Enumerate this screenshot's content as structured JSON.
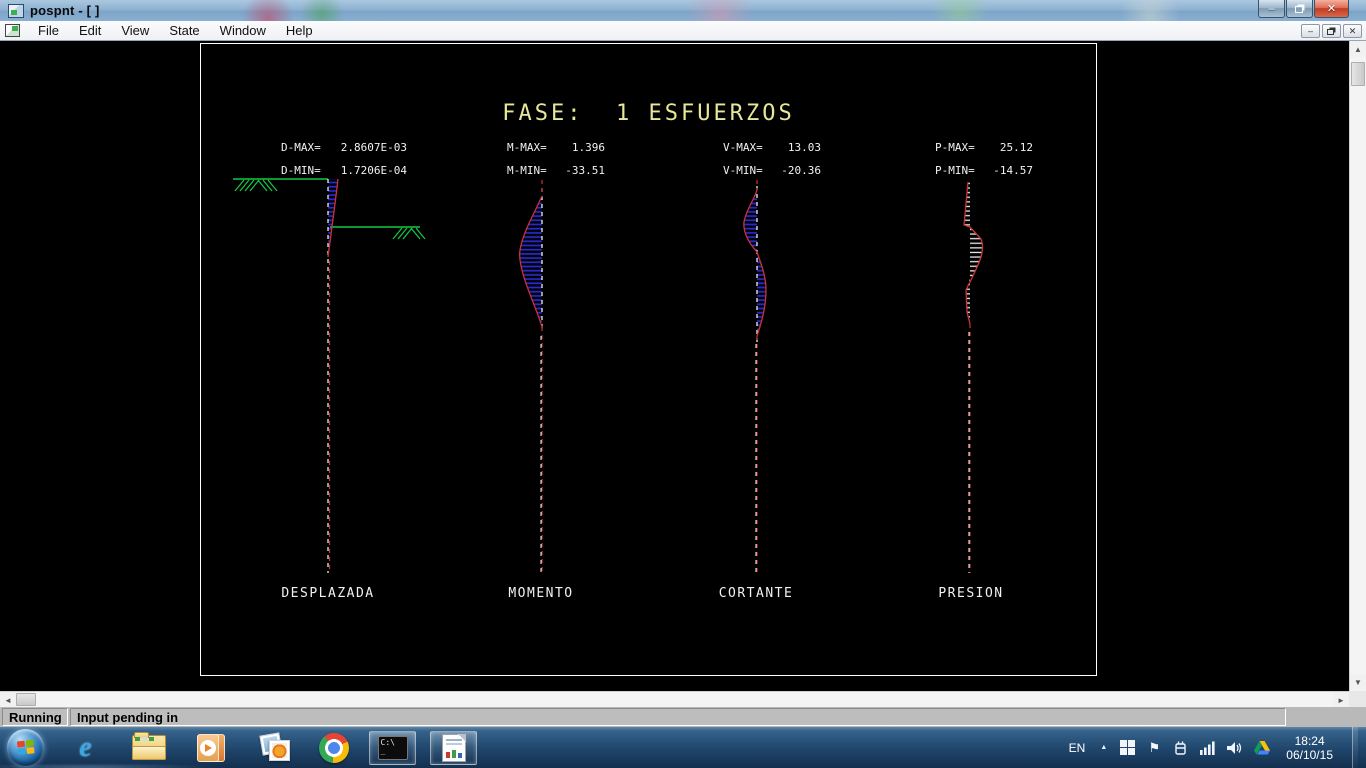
{
  "titlebar": {
    "title": "pospnt - [ ]"
  },
  "icons": {
    "minimize": "–",
    "close": "✕",
    "mdi_minimize": "–",
    "mdi_close": "✕",
    "vscroll_up": "▲",
    "vscroll_down": "▼",
    "hscroll_left": "◄",
    "hscroll_right": "►",
    "tray_chevron": "▲",
    "flag": "⚑",
    "console_line1": "C:\\",
    "console_line2": "_"
  },
  "menubar": {
    "items": [
      "File",
      "Edit",
      "View",
      "State",
      "Window",
      "Help"
    ]
  },
  "plot": {
    "title": "FASE:  1 ESFUERZOS",
    "stats": [
      {
        "max_label": "D-MAX=",
        "max_value": "2.8607E-03",
        "min_label": "D-MIN=",
        "min_value": "1.7206E-04"
      },
      {
        "max_label": "M-MAX=",
        "max_value": "1.396",
        "min_label": "M-MIN=",
        "min_value": "-33.51"
      },
      {
        "max_label": "V-MAX=",
        "max_value": "13.03",
        "min_label": "V-MIN=",
        "min_value": "-20.36"
      },
      {
        "max_label": "P-MAX=",
        "max_value": "25.12",
        "min_label": "P-MIN=",
        "min_value": "-14.57"
      }
    ],
    "diagram_labels": [
      "DESPLAZADA",
      "MOMENTO",
      "CORTANTE",
      "PRESION"
    ],
    "colors": {
      "title_text": "#e8e89a",
      "stat_text": "#f2f2f2",
      "ground": "#11cc44",
      "deflection_fill": "#2828cc",
      "outline": "#cc3333",
      "axis": "#ffffff"
    }
  },
  "chart_data": [
    {
      "type": "line",
      "title": "DESPLAZADA",
      "description": "wall deflection diagram with ground lines",
      "max": 0.0028607,
      "min": 0.00017206
    },
    {
      "type": "area",
      "title": "MOMENTO",
      "description": "bending moment diagram along wall",
      "max": 1.396,
      "min": -33.51
    },
    {
      "type": "area",
      "title": "CORTANTE",
      "description": "shear force diagram along wall",
      "max": 13.03,
      "min": -20.36
    },
    {
      "type": "area",
      "title": "PRESION",
      "description": "earth pressure diagram along wall",
      "max": 25.12,
      "min": -14.57
    }
  ],
  "statusbar": {
    "state": "Running",
    "message": "Input pending in"
  },
  "taskbar": {
    "items": [
      "start",
      "internet-explorer",
      "windows-explorer",
      "media-player",
      "photo-viewer",
      "chrome",
      "command-prompt",
      "pospnt-graphics"
    ],
    "tray": {
      "language": "EN",
      "time": "18:24",
      "date": "06/10/15"
    }
  }
}
